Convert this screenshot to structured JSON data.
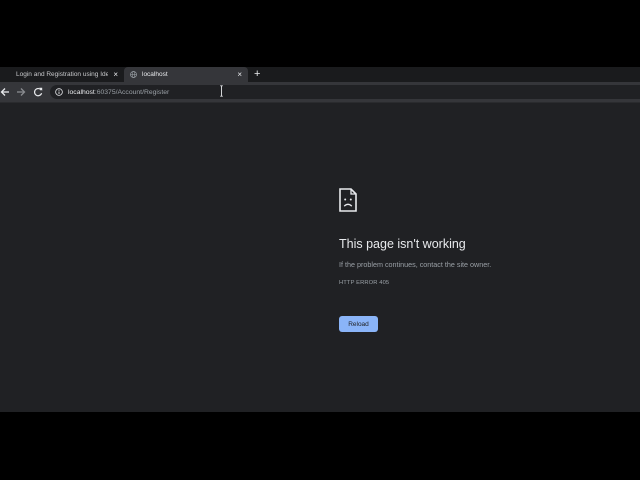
{
  "tabs": [
    {
      "label": "Login and Registration using Identity",
      "close": "×"
    },
    {
      "label": "localhost",
      "close": "×"
    }
  ],
  "new_tab": "+",
  "address_bar": {
    "host": "localhost",
    "path": ":60375/Account/Register"
  },
  "error": {
    "title": "This page isn't working",
    "message": "If the problem continues, contact the site owner.",
    "code": "HTTP ERROR 405",
    "reload_label": "Reload"
  },
  "colors": {
    "accent": "#8ab4f8",
    "page_bg": "#202124",
    "toolbar_bg": "#35363a"
  },
  "icons": {
    "back": "arrow-left-icon",
    "forward": "arrow-right-icon",
    "reload": "reload-icon",
    "info": "info-icon",
    "tab_favicon": "globe-icon",
    "error": "sad-page-icon",
    "cursor": "text-cursor-icon"
  }
}
